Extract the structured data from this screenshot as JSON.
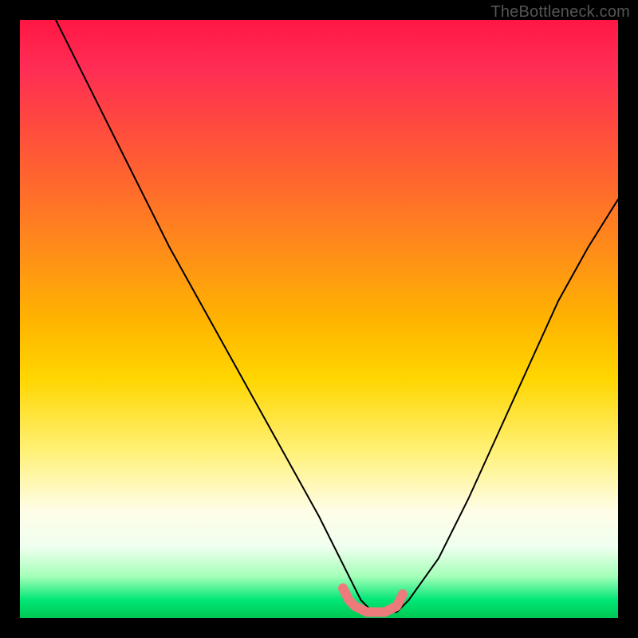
{
  "watermark": "TheBottleneck.com",
  "chart_data": {
    "type": "line",
    "title": "",
    "xlabel": "",
    "ylabel": "",
    "xlim": [
      0,
      100
    ],
    "ylim": [
      0,
      100
    ],
    "grid": false,
    "legend": false,
    "background_gradient": {
      "from": "#ff1744",
      "mid": "#ffd600",
      "to": "#00c853",
      "direction": "vertical",
      "maps_to": "bottleneck_percent"
    },
    "series": [
      {
        "name": "bottleneck_curve",
        "color": "#000000",
        "x": [
          6,
          10,
          15,
          20,
          25,
          30,
          35,
          40,
          45,
          50,
          53,
          55,
          57,
          59,
          61,
          63,
          65,
          70,
          75,
          80,
          85,
          90,
          95,
          100
        ],
        "values": [
          100,
          92,
          82,
          72,
          62,
          53,
          44,
          35,
          26,
          17,
          11,
          7,
          3,
          1,
          1,
          1,
          3,
          10,
          20,
          31,
          42,
          53,
          62,
          70
        ]
      },
      {
        "name": "optimal_band_marker",
        "color": "#e57373",
        "style": "thick-rounded",
        "x": [
          54,
          55,
          56,
          57,
          58,
          59,
          60,
          61,
          62,
          63,
          64
        ],
        "values": [
          5,
          3,
          2,
          1.5,
          1,
          1,
          1,
          1,
          1.5,
          2,
          4
        ]
      }
    ],
    "annotations": []
  }
}
